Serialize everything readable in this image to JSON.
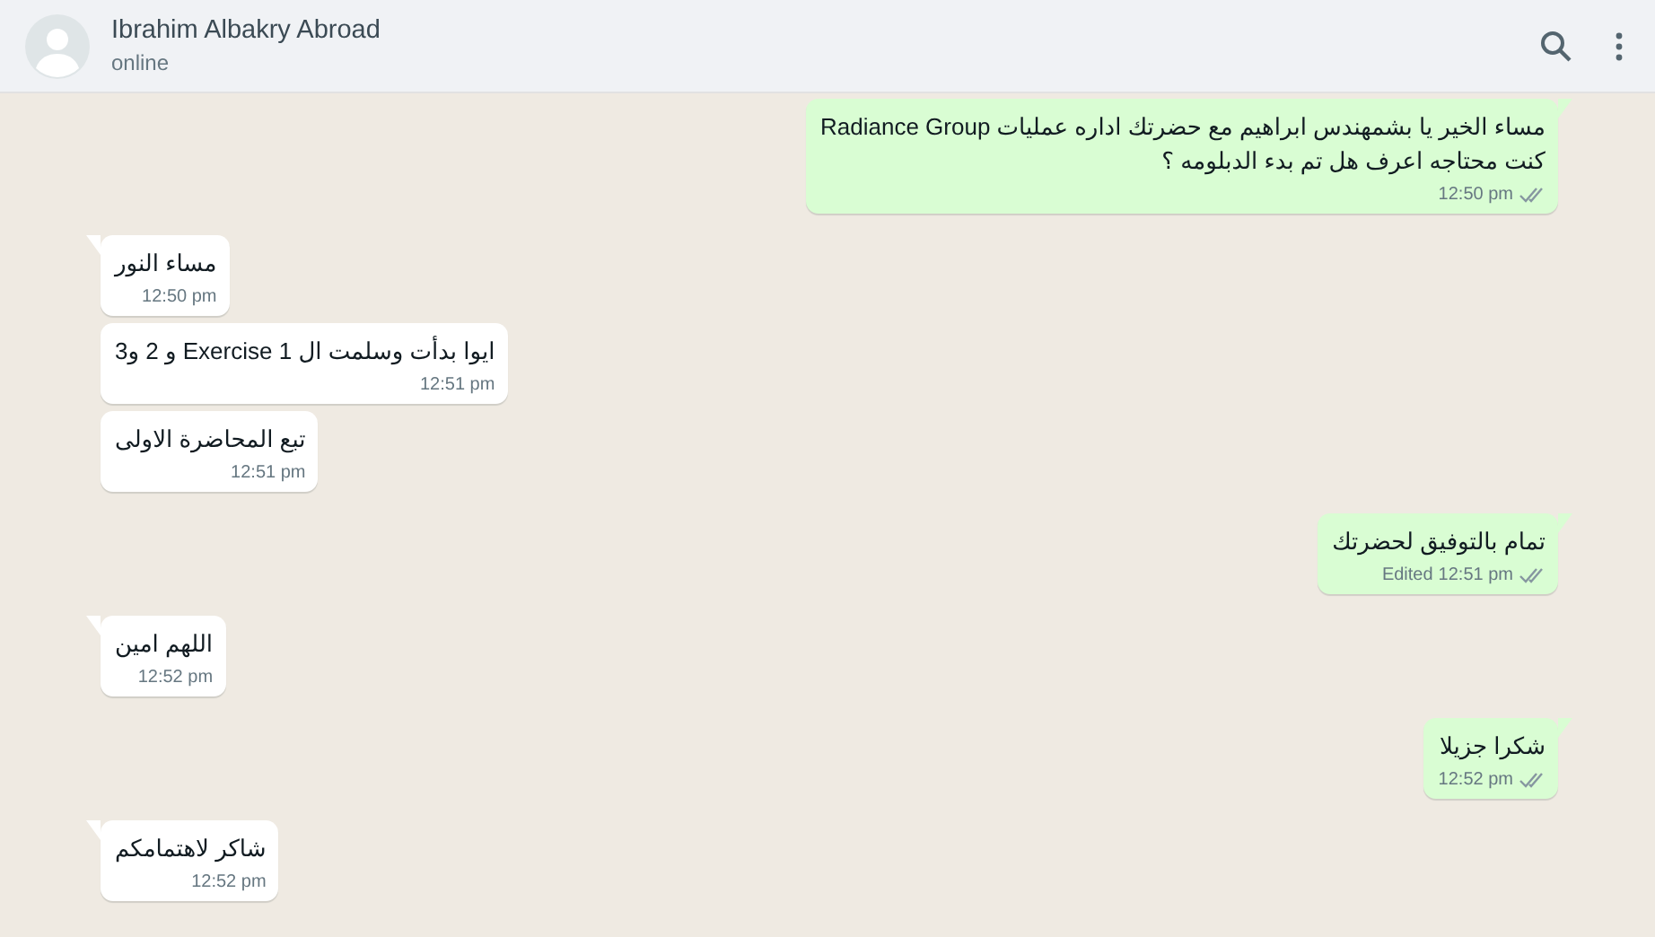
{
  "header": {
    "contact_name": "Ibrahim Albakry Abroad",
    "status": "online"
  },
  "messages": [
    {
      "outgoing": true,
      "lines": [
        "مساء الخير يا بشمهندس ابراهيم مع حضرتك اداره عمليات Radiance Group",
        "كنت محتاجه اعرف هل تم بدء الدبلومه ؟"
      ],
      "time": "12:50 pm",
      "read": false
    },
    {
      "outgoing": false,
      "lines": [
        "مساء النور"
      ],
      "time": "12:50 pm"
    },
    {
      "outgoing": false,
      "lines": [
        "ايوا بدأت وسلمت ال Exercise 1 و 2 و3"
      ],
      "time": "12:51 pm"
    },
    {
      "outgoing": false,
      "lines": [
        "تبع المحاضرة الاولى"
      ],
      "time": "12:51 pm"
    },
    {
      "outgoing": true,
      "lines": [
        "تمام بالتوفيق لحضرتك"
      ],
      "edited_label": "Edited",
      "time": "12:51 pm",
      "read": false
    },
    {
      "outgoing": false,
      "lines": [
        "اللهم امين"
      ],
      "time": "12:52 pm"
    },
    {
      "outgoing": true,
      "lines": [
        "شكرا جزيلا"
      ],
      "time": "12:52 pm",
      "read": false
    },
    {
      "outgoing": false,
      "lines": [
        "شاكر لاهتمامكم"
      ],
      "time": "12:52 pm"
    }
  ]
}
